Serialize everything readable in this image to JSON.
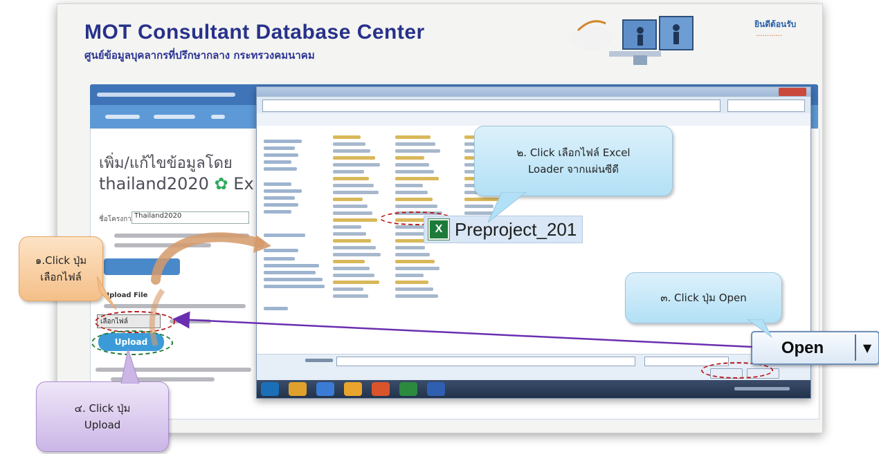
{
  "site": {
    "title": "MOT Consultant Database Center",
    "subtitle": "ศูนย์ข้อมูลบุคลากรที่ปรึกษากลาง กระทรวงคมนาคม"
  },
  "form": {
    "page_title_line1": "เพิ่ม/แก้ไขข้อมูลโดย",
    "page_title_line2_text": "thailand2020",
    "page_title_line2_suffix": "Ex",
    "project_field_value": "Thailand2020",
    "upload_label": "Upload File",
    "upload_button": "Upload"
  },
  "dialog": {
    "selected_file": "Preproject_201",
    "open_button": "Open"
  },
  "callouts": {
    "step1": "๑.Click ปุ่ม\nเลือกไฟล์",
    "step2": "๒. Click เลือกไฟล์ Excel\nLoader จากแผ่นซีดี",
    "step3": "๓. Click ปุ่ม Open",
    "step4": "๔. Click ปุ่ม\nUpload"
  },
  "colors": {
    "title_blue": "#27318a",
    "nav_blue": "#3f74b8",
    "nav_light_blue": "#5d99d6",
    "arrow_purple": "#6a2fb0",
    "dashed_red": "#b81a1a",
    "dashed_green": "#1b7a2a",
    "callout_blue": "#b2e0f6",
    "callout_orange": "#f4bf88",
    "callout_purple": "#cbb6e6"
  },
  "icons": {
    "excel_file": "excel-file-icon",
    "dropdown_arrow": "dropdown-arrow-icon"
  }
}
